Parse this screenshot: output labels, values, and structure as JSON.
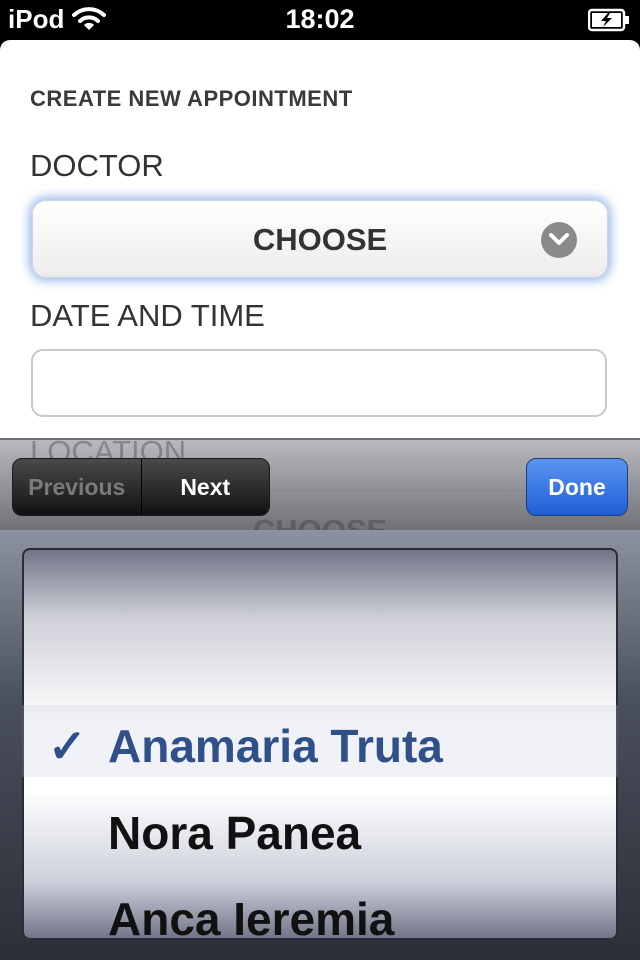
{
  "status_bar": {
    "carrier": "iPod",
    "time": "18:02"
  },
  "form": {
    "title": "CREATE NEW APPOINTMENT",
    "doctor_label": "DOCTOR",
    "doctor_select_value": "CHOOSE",
    "datetime_label": "DATE AND TIME",
    "datetime_value": "",
    "location_label": "LOCATION",
    "location_select_value": "CHOOSE"
  },
  "toolbar": {
    "previous_label": "Previous",
    "next_label": "Next",
    "done_label": "Done"
  },
  "picker": {
    "selected": "Anamaria Truta",
    "check_glyph": "✓",
    "options": [
      "Anamaria Truta",
      "Nora Panea",
      "Anca Ieremia"
    ]
  },
  "colors": {
    "accent": "#30508a",
    "done_button": "#2f6fe0",
    "focus_glow": "#78a0e6"
  }
}
